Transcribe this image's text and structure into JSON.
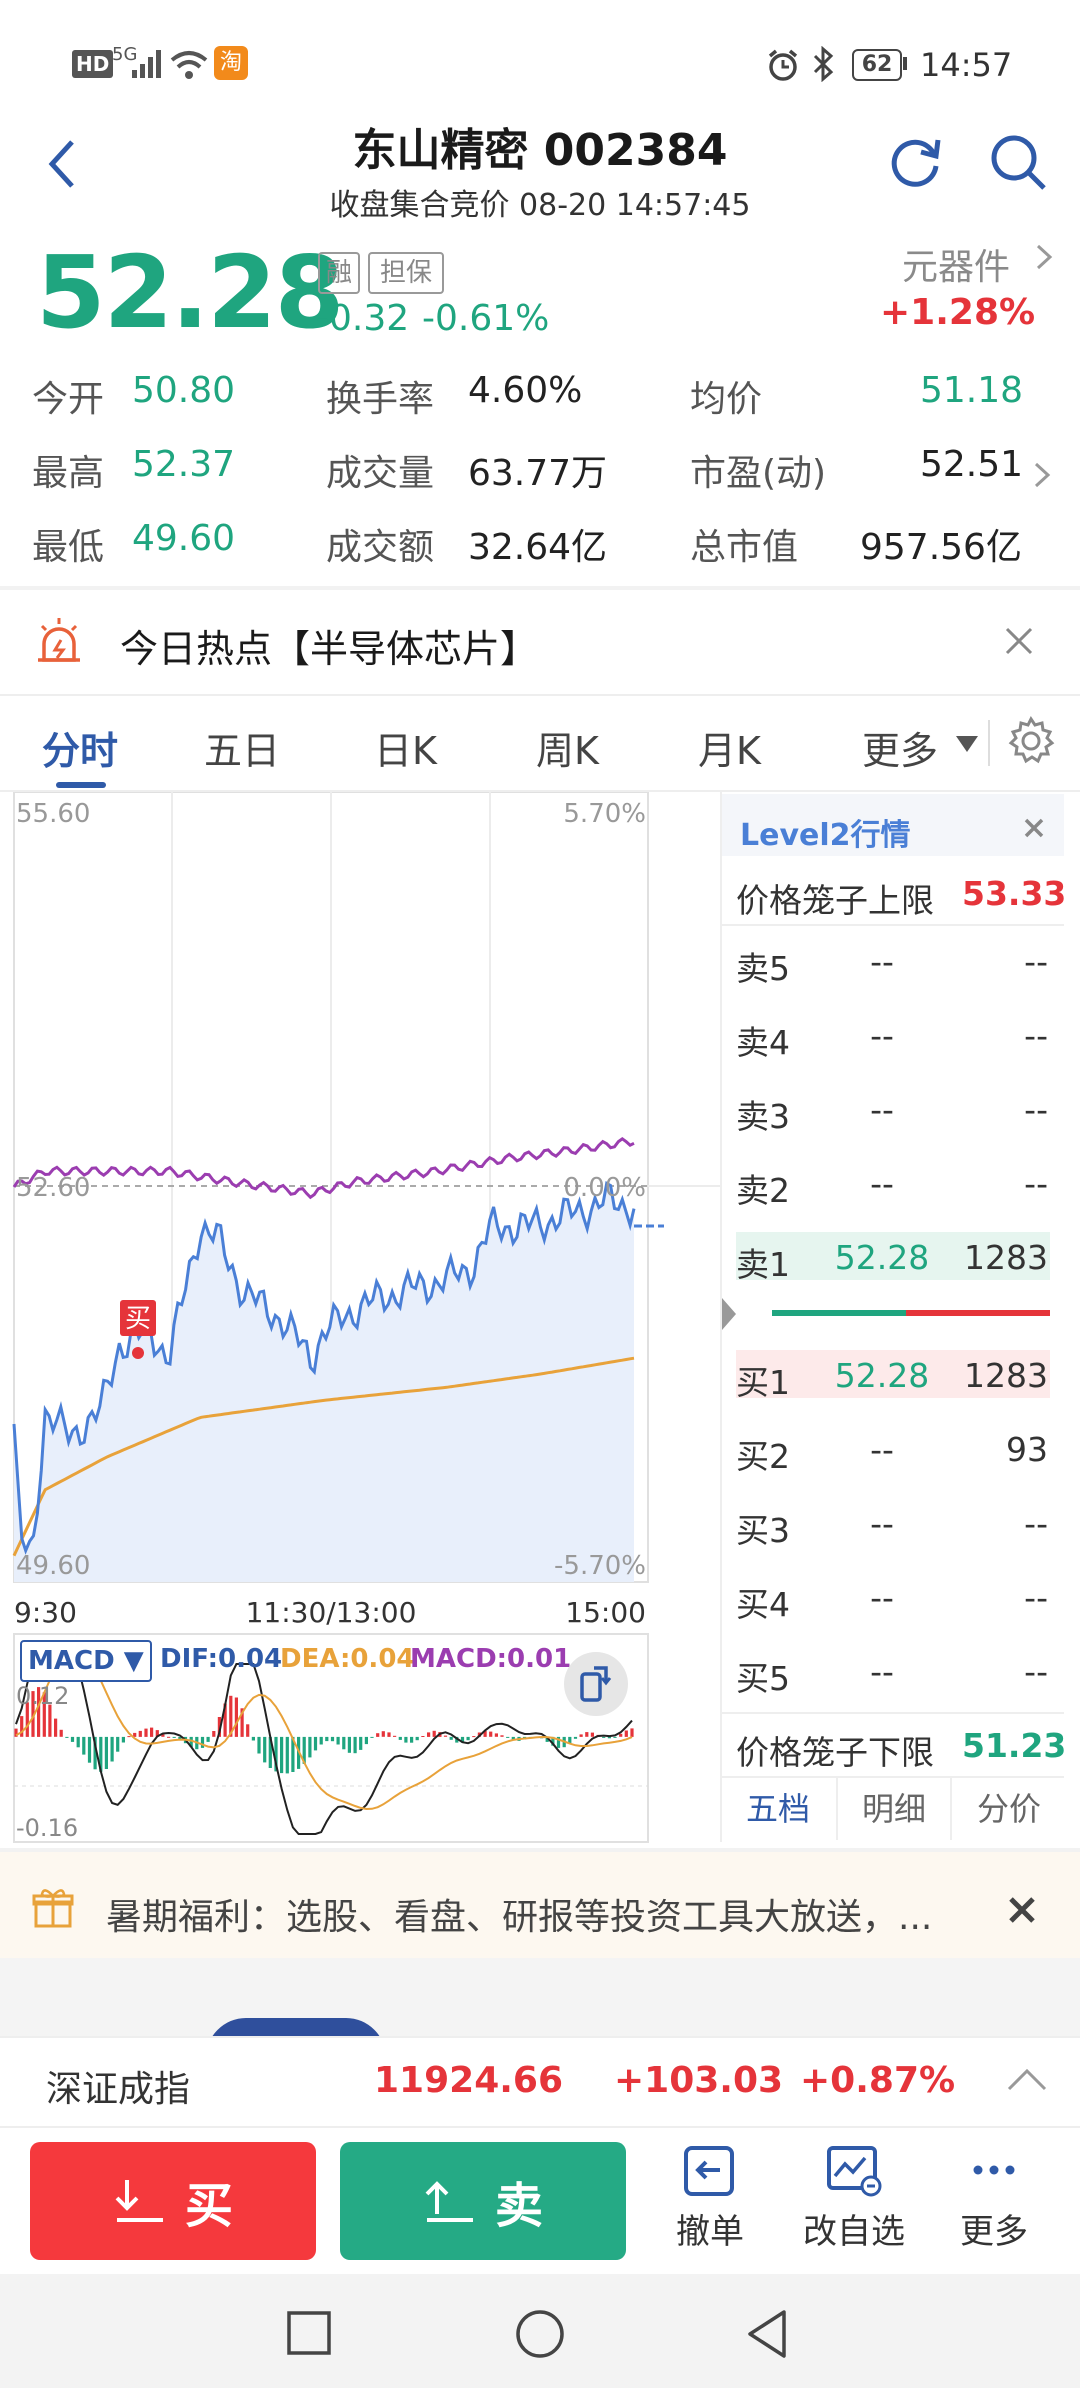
{
  "status_bar": {
    "network": "HD",
    "signal": "5G",
    "taobao": "淘",
    "battery": "62",
    "time": "14:57"
  },
  "header": {
    "title": "东山精密 002384",
    "subtitle": "收盘集合竞价 08-20 14:57:45"
  },
  "quote": {
    "price": "52.28",
    "tag1": "融",
    "tag2": "担保",
    "change": "-0.32",
    "change_pct": "-0.61%",
    "sector_name": "元器件",
    "sector_change": "+1.28%",
    "stats": [
      {
        "label": "今开",
        "value": "50.80"
      },
      {
        "label": "换手率",
        "value": "4.60%"
      },
      {
        "label": "均价",
        "value": "51.18"
      },
      {
        "label": "最高",
        "value": "52.37"
      },
      {
        "label": "成交量",
        "value": "63.77万"
      },
      {
        "label": "市盈(动)",
        "value": "52.51"
      },
      {
        "label": "最低",
        "value": "49.60"
      },
      {
        "label": "成交额",
        "value": "32.64亿"
      },
      {
        "label": "总市值",
        "value": "957.56亿"
      }
    ]
  },
  "hot_banner": {
    "text": "今日热点【半导体芯片】"
  },
  "tabs": [
    "分时",
    "五日",
    "日K",
    "周K",
    "月K",
    "更多"
  ],
  "chart": {
    "y_top": "55.60",
    "y_mid": "52.60",
    "y_bottom": "49.60",
    "pct_top": "5.70%",
    "pct_mid": "0.00%",
    "pct_bottom": "-5.70%",
    "x_start": "9:30",
    "x_mid": "11:30/13:00",
    "x_end": "15:00",
    "buy_marker": "买",
    "colors": {
      "price": "#4a7fd6",
      "avg": "#e8a23a",
      "index": "#9b3db0"
    }
  },
  "macd": {
    "selector": "MACD",
    "dif": "DIF:0.04",
    "dea": "DEA:0.04",
    "macd": "MACD:0.01",
    "top": "0.12",
    "bottom": "-0.16"
  },
  "level2": {
    "title": "Level2行情",
    "upper_label": "价格笼子上限",
    "upper_value": "53.33",
    "lower_label": "价格笼子下限",
    "lower_value": "51.23",
    "sells": [
      {
        "label": "卖5",
        "price": "--",
        "vol": "--"
      },
      {
        "label": "卖4",
        "price": "--",
        "vol": "--"
      },
      {
        "label": "卖3",
        "price": "--",
        "vol": "--"
      },
      {
        "label": "卖2",
        "price": "--",
        "vol": "--"
      },
      {
        "label": "卖1",
        "price": "52.28",
        "vol": "1283"
      }
    ],
    "buys": [
      {
        "label": "买1",
        "price": "52.28",
        "vol": "1283"
      },
      {
        "label": "买2",
        "price": "--",
        "vol": "93"
      },
      {
        "label": "买3",
        "price": "--",
        "vol": "--"
      },
      {
        "label": "买4",
        "price": "--",
        "vol": "--"
      },
      {
        "label": "买5",
        "price": "--",
        "vol": "--"
      }
    ],
    "tabs": [
      "五档",
      "明细",
      "分价"
    ]
  },
  "promo": {
    "text": "暑期福利：选股、看盘、研报等投资工具大放送，..."
  },
  "index_bar": {
    "name": "深证成指",
    "value": "11924.66",
    "change": "+103.03",
    "change_pct": "+0.87%"
  },
  "actions": {
    "buy": "买",
    "sell": "卖",
    "cancel": "撤单",
    "edit_watch": "改自选",
    "more": "更多"
  }
}
